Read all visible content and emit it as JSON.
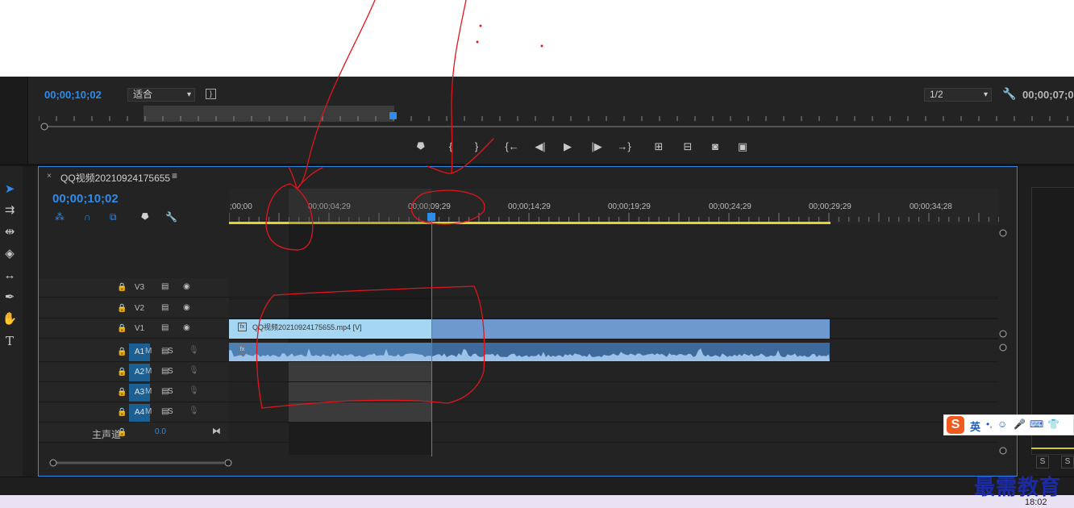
{
  "program_monitor": {
    "timecode": "00;00;10;02",
    "zoom_select": "适合",
    "resolution_select": "1/2",
    "duration": "00;00;07;0"
  },
  "transport_icons": [
    "add-marker-icon",
    "mark-in-icon",
    "mark-out-icon",
    "go-to-in-icon",
    "step-back-icon",
    "play-icon",
    "step-forward-icon",
    "go-to-out-icon",
    "lift-icon",
    "extract-icon",
    "export-frame-icon",
    "comparison-view-icon"
  ],
  "tools": [
    "selection-tool-icon",
    "track-select-tool-icon",
    "ripple-edit-tool-icon",
    "razor-tool-icon",
    "slip-tool-icon",
    "pen-tool-icon",
    "hand-tool-icon",
    "type-tool-icon"
  ],
  "timeline": {
    "close_glyph": "×",
    "sequence_name": "QQ视频20210924175655",
    "menu_glyph": "≡",
    "timecode": "00;00;10;02",
    "ruler_ticks": [
      ";00;00",
      "00;00;04;29",
      "00;00;09;29",
      "00;00;14;29",
      "00;00;19;29",
      "00;00;24;29",
      "00;00;29;29",
      "00;00;34;28"
    ],
    "video_tracks": [
      {
        "name": "V3",
        "targeted": false
      },
      {
        "name": "V2",
        "targeted": false
      },
      {
        "name": "V1",
        "targeted": true
      }
    ],
    "audio_tracks": [
      {
        "name": "A1",
        "targeted": true
      },
      {
        "name": "A2",
        "targeted": true
      },
      {
        "name": "A3",
        "targeted": true
      },
      {
        "name": "A4",
        "targeted": true
      }
    ],
    "audio_mute_label": "M",
    "audio_solo_label": "S",
    "master_label": "主声道",
    "master_value": "0.0",
    "video_clip_label": "QQ视频20210924175655.mp4 [V]"
  },
  "right_panel": {
    "solo_labels": [
      "S",
      "S"
    ]
  },
  "ime": {
    "logo": "S",
    "mode": "英"
  },
  "watermark": "最需教育",
  "taskbar": {
    "time": "18:02"
  },
  "colors": {
    "accent": "#2d8ceb",
    "video_clip": "#6e99cf",
    "video_clip_selected": "#a6d7f2",
    "audio_clip": "#3d6a9a",
    "work_area": "#e4d32c",
    "annotation": "#e0161c"
  }
}
